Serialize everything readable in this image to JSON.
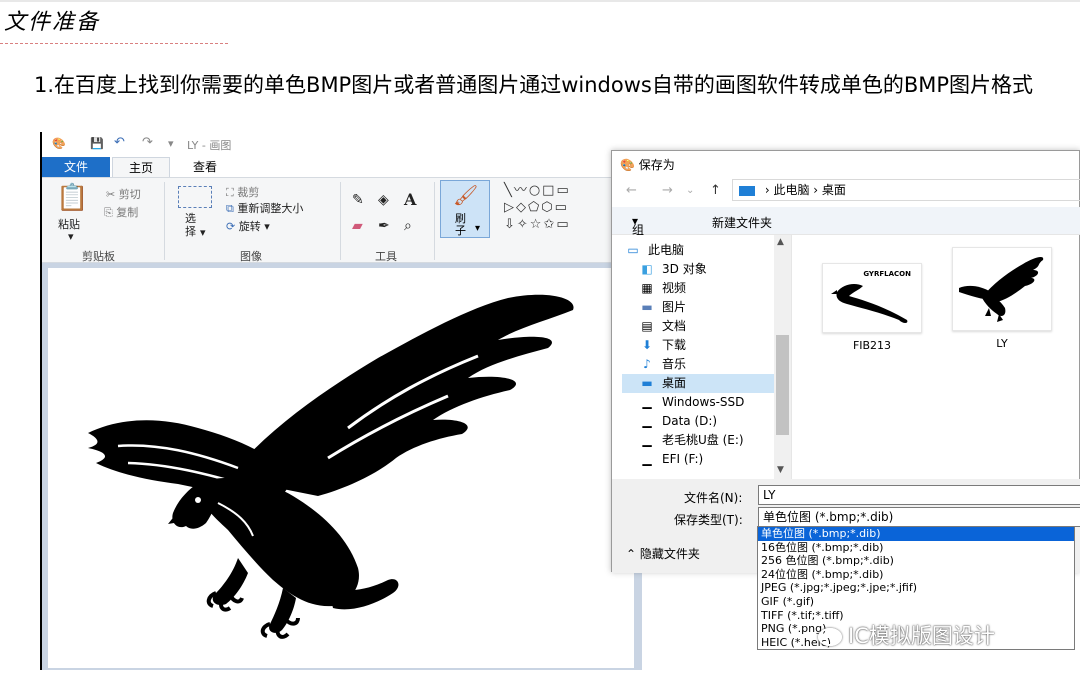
{
  "slide": {
    "section_title": "文件准备",
    "instruction": "1.在百度上找到你需要的单色BMP图片或者普通图片通过windows自带的画图软件转成单色的BMP图片格式"
  },
  "paint": {
    "window_title": "LY - 画图",
    "tabs": [
      "文件",
      "主页",
      "查看"
    ],
    "clipboard": {
      "paste": "粘贴",
      "cut": "剪切",
      "copy": "复制",
      "label": "剪贴板"
    },
    "image": {
      "select": "选择",
      "crop": "裁剪",
      "resize": "重新调整大小",
      "rotate": "旋转",
      "label": "图像"
    },
    "tools": {
      "label": "工具"
    },
    "brush": {
      "label": "刷子"
    }
  },
  "save_dialog": {
    "title": "保存为",
    "breadcrumb": [
      "此电脑",
      "桌面"
    ],
    "toolbar": {
      "organize": "组织",
      "new_folder": "新建文件夹"
    },
    "nav_items": [
      {
        "icon": "computer-icon",
        "label": "此电脑"
      },
      {
        "icon": "cube-3d-icon",
        "label": "3D 对象"
      },
      {
        "icon": "video-icon",
        "label": "视频"
      },
      {
        "icon": "picture-icon",
        "label": "图片"
      },
      {
        "icon": "document-icon",
        "label": "文档"
      },
      {
        "icon": "download-icon",
        "label": "下载"
      },
      {
        "icon": "music-icon",
        "label": "音乐"
      },
      {
        "icon": "desktop-icon",
        "label": "桌面"
      },
      {
        "icon": "drive-icon",
        "label": "Windows-SSD"
      },
      {
        "icon": "drive-icon",
        "label": "Data (D:)"
      },
      {
        "icon": "drive-icon",
        "label": "老毛桃U盘 (E:)"
      },
      {
        "icon": "drive-icon",
        "label": "EFI (F:)"
      }
    ],
    "files": [
      {
        "name": "FIB213",
        "thumb_text": "GYRFLACON"
      },
      {
        "name": "LY"
      }
    ],
    "filename_label": "文件名(N):",
    "filename_value": "LY",
    "filetype_label": "保存类型(T):",
    "filetype_value": "单色位图 (*.bmp;*.dib)",
    "hide_folders": "隐藏文件夹",
    "filetype_options": [
      "单色位图 (*.bmp;*.dib)",
      "16色位图 (*.bmp;*.dib)",
      "256 色位图 (*.bmp;*.dib)",
      "24位位图 (*.bmp;*.dib)",
      "JPEG (*.jpg;*.jpeg;*.jpe;*.jfif)",
      "GIF (*.gif)",
      "TIFF (*.tif;*.tiff)",
      "PNG (*.png)",
      "HEIC (*.heic)"
    ]
  },
  "watermark": "IC模拟版图设计",
  "colors": {
    "ribbon_blue": "#1e6fc8",
    "selection": "#0a64d8",
    "canvas_bg": "#c9d4e3"
  }
}
